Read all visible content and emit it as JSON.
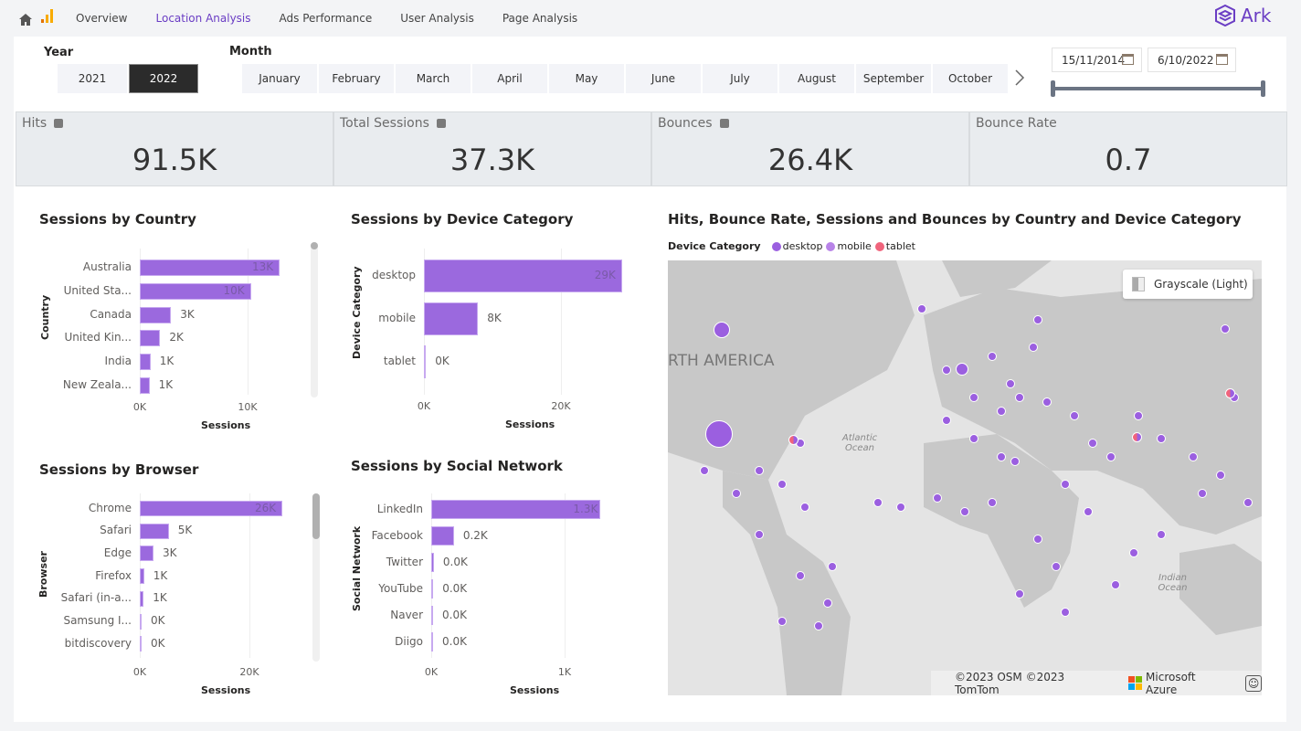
{
  "nav": {
    "tabs": [
      "Overview",
      "Location Analysis",
      "Ads Performance",
      "User Analysis",
      "Page Analysis"
    ],
    "active": "Location Analysis",
    "brand": "Ark"
  },
  "filters": {
    "year_label": "Year",
    "years": [
      "2021",
      "2022"
    ],
    "selected_year": "2022",
    "month_label": "Month",
    "months": [
      "January",
      "February",
      "March",
      "April",
      "May",
      "June",
      "July",
      "August",
      "September",
      "October"
    ],
    "start_date": "15/11/2014",
    "end_date": "6/10/2022"
  },
  "kpis": [
    {
      "title": "Hits",
      "value": "91.5K",
      "info": true
    },
    {
      "title": "Total Sessions",
      "value": "37.3K",
      "info": true
    },
    {
      "title": "Bounces",
      "value": "26.4K",
      "info": true
    },
    {
      "title": "Bounce Rate",
      "value": "0.7",
      "info": false
    }
  ],
  "chart_data": [
    {
      "type": "bar",
      "orientation": "horizontal",
      "title": "Sessions by Country",
      "xlabel": "Sessions",
      "ylabel": "Country",
      "categories": [
        "Australia",
        "United Sta...",
        "Canada",
        "United Kin...",
        "India",
        "New Zeala..."
      ],
      "values": [
        12970,
        10300,
        2900,
        1900,
        1000,
        900
      ],
      "data_labels": [
        "13K",
        "10K",
        "3K",
        "2K",
        "1K",
        "1K"
      ],
      "ticks": [
        "0K",
        "10K"
      ],
      "tick_values": [
        0,
        10000
      ],
      "color": "#9b69de"
    },
    {
      "type": "bar",
      "orientation": "horizontal",
      "title": "Sessions by Device Category",
      "xlabel": "Sessions",
      "ylabel": "Device Category",
      "categories": [
        "desktop",
        "mobile",
        "tablet"
      ],
      "values": [
        28900,
        7900,
        300
      ],
      "data_labels": [
        "29K",
        "8K",
        "0K"
      ],
      "ticks": [
        "0K",
        "20K"
      ],
      "tick_values": [
        0,
        20000
      ],
      "color": "#9b69de"
    },
    {
      "type": "bar",
      "orientation": "horizontal",
      "title": "Sessions by Browser",
      "xlabel": "Sessions",
      "ylabel": "Browser",
      "categories": [
        "Chrome",
        "Safari",
        "Edge",
        "Firefox",
        "Safari (in-a...",
        "Samsung I...",
        "bitdiscovery"
      ],
      "values": [
        26000,
        5300,
        2500,
        800,
        700,
        200,
        100
      ],
      "data_labels": [
        "26K",
        "5K",
        "3K",
        "1K",
        "1K",
        "0K",
        "0K"
      ],
      "ticks": [
        "0K",
        "20K"
      ],
      "tick_values": [
        0,
        20000
      ],
      "color": "#9b69de"
    },
    {
      "type": "bar",
      "orientation": "horizontal",
      "title": "Sessions by Social Network",
      "xlabel": "Sessions",
      "ylabel": "Social Network",
      "categories": [
        "LinkedIn",
        "Facebook",
        "Twitter",
        "YouTube",
        "Naver",
        "Diigo"
      ],
      "values": [
        1270,
        170,
        20,
        15,
        12,
        10
      ],
      "data_labels": [
        "1.3K",
        "0.2K",
        "0.0K",
        "0.0K",
        "0.0K",
        "0.0K"
      ],
      "ticks": [
        "0K",
        "1K"
      ],
      "tick_values": [
        0,
        1000
      ],
      "color": "#9b69de"
    }
  ],
  "map": {
    "title": "Hits, Bounce Rate, Sessions and Bounces by Country and Device Category",
    "legend_title": "Device Category",
    "legend": [
      {
        "name": "desktop",
        "color": "#9b5fe0"
      },
      {
        "name": "mobile",
        "color": "#b883e8"
      },
      {
        "name": "tablet",
        "color": "#f0647c"
      }
    ],
    "style_button": "Grayscale (Light)",
    "labels": [
      "RTH AMERICA",
      "Atlantic Ocean",
      "Indian Ocean"
    ],
    "attribution": "©2023 OSM ©2023 TomTom",
    "provider": "Microsoft Azure"
  }
}
